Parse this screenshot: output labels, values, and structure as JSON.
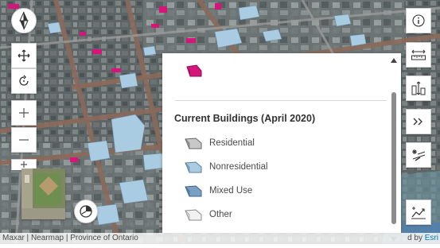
{
  "legend": {
    "title": "Current Buildings (April 2020)",
    "items": [
      {
        "label": "Residential",
        "color": "#c8c8c8"
      },
      {
        "label": "Nonresidential",
        "color": "#a9cce3"
      },
      {
        "label": "Mixed Use",
        "color": "#7aa0c4"
      },
      {
        "label": "Other",
        "color": "#f2f2f2"
      }
    ],
    "top_symbol_color": "#d6157a"
  },
  "attribution": {
    "text": "Maxar | Nearmap | Province of Ontario",
    "powered_prefix": "d by",
    "powered_brand": "Esri"
  },
  "icons": {
    "compass": "compass-icon",
    "pan": "pan-icon",
    "rotate": "rotate-icon",
    "zoom_in": "plus-icon",
    "zoom_out": "minus-icon",
    "daylight": "daylight-icon",
    "info": "info-icon",
    "distance": "measure-distance-icon",
    "height": "measure-height-icon",
    "expand": "double-chevron-icon",
    "slice": "slice-icon",
    "elevation": "elevation-profile-icon"
  },
  "map": {
    "basemap": "aerial-3d-city",
    "highlight_color": "#d6157a"
  }
}
